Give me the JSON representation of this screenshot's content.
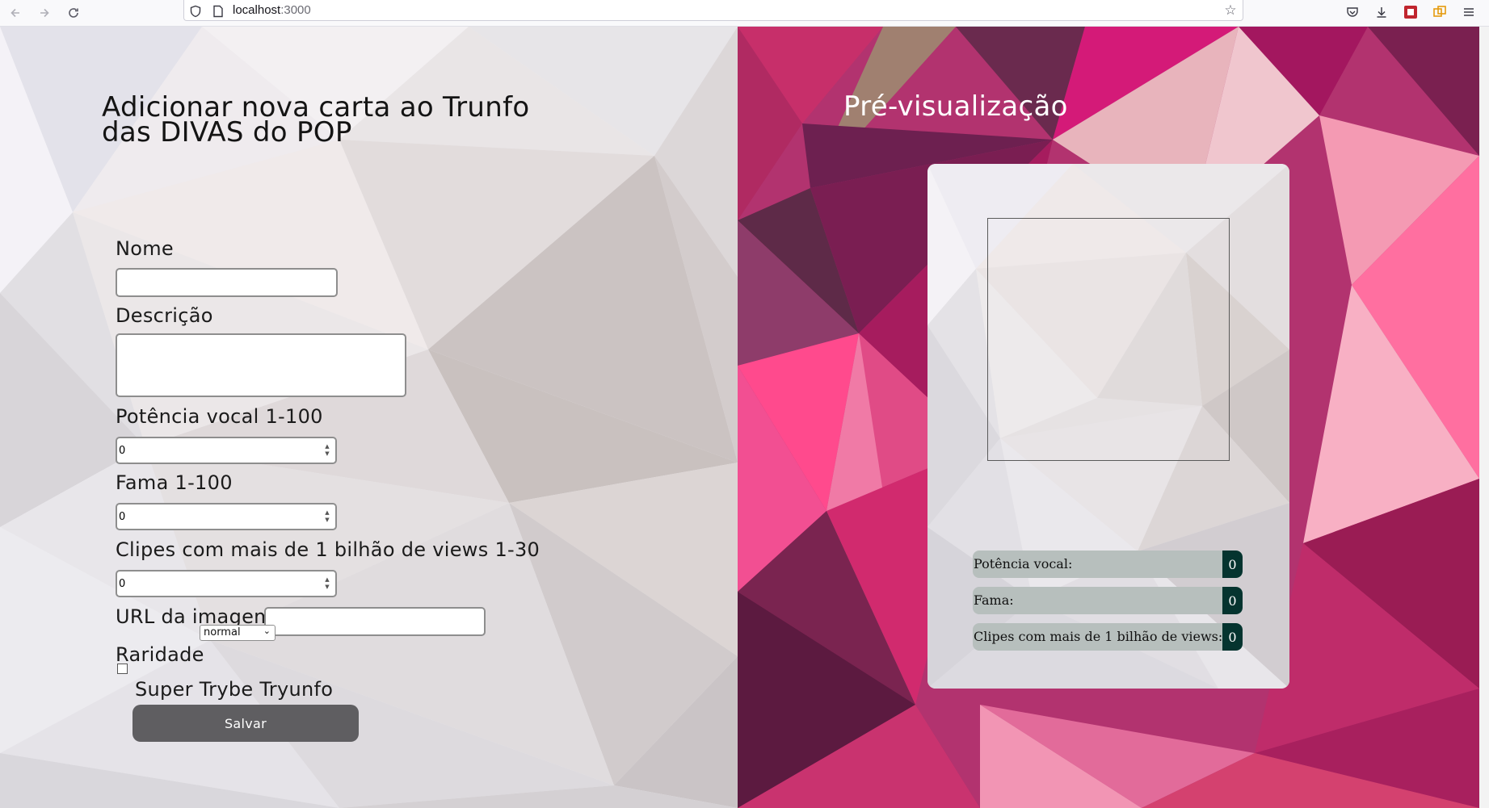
{
  "browser": {
    "url_host": "localhost",
    "url_port": ":3000",
    "icons": [
      "back-arrow-icon",
      "forward-arrow-icon",
      "reload-icon",
      "shield-icon",
      "page-icon",
      "bookmark-star-icon",
      "pocket-icon",
      "download-icon",
      "extension-icon",
      "extensions-puzzle-icon",
      "menu-icon"
    ]
  },
  "form": {
    "title": "Adicionar nova carta ao Trunfo das DIVAS do POP",
    "name_label": "Nome",
    "name_value": "",
    "description_label": "Descrição",
    "description_value": "",
    "vocal_label": "Potência vocal 1-100",
    "vocal_value": "0",
    "fame_label": "Fama 1-100",
    "fame_value": "0",
    "clips_label": "Clipes com mais de 1 bilhão de views 1-30",
    "clips_value": "0",
    "image_url_label": "URL da imagem",
    "image_url_value": "",
    "rarity_label": "Raridade",
    "rarity_selected": "normal",
    "super_trunfo_label": "Super Trybe Tryunfo",
    "super_trunfo_checked": false,
    "save_label": "Salvar"
  },
  "preview": {
    "title": "Pré-visualização",
    "attributes": [
      {
        "label": "Potência vocal:",
        "value": "0"
      },
      {
        "label": "Fama:",
        "value": "0"
      },
      {
        "label": "Clipes com mais de 1 bilhão de views:",
        "value": "0"
      }
    ]
  },
  "colors": {
    "left_background": "#ecebef",
    "right_background": "#b2336f",
    "save_button": "#5f5e61",
    "attribute_row": "#b7bfbd",
    "attribute_value": "#05342f"
  }
}
